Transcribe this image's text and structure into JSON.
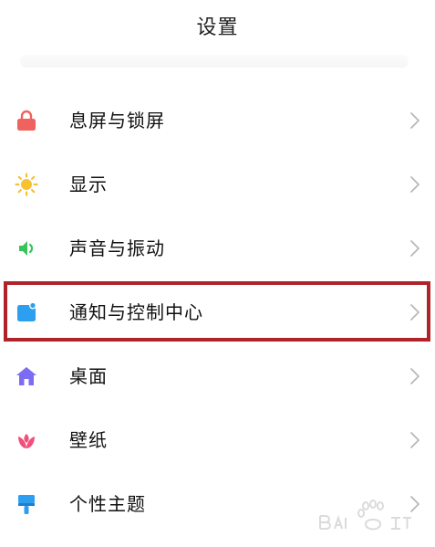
{
  "header": {
    "title": "设置"
  },
  "menu": {
    "items": [
      {
        "label": "息屏与锁屏",
        "icon": "lock-icon",
        "color": "#f0625d"
      },
      {
        "label": "显示",
        "icon": "sun-icon",
        "color": "#f8c12f"
      },
      {
        "label": "声音与振动",
        "icon": "speaker-icon",
        "color": "#37c45a"
      },
      {
        "label": "通知与控制中心",
        "icon": "notification-icon",
        "color": "#2d9ff0"
      },
      {
        "label": "桌面",
        "icon": "home-icon",
        "color": "#7b6cf3"
      },
      {
        "label": "壁纸",
        "icon": "flower-icon",
        "color": "#f0507c"
      },
      {
        "label": "个性主题",
        "icon": "brush-icon",
        "color": "#2d9ff0"
      }
    ],
    "highlighted_index": 3,
    "highlight_color": "#b0232a"
  },
  "watermark": {
    "icon": "baidu-jingyan-logo"
  }
}
